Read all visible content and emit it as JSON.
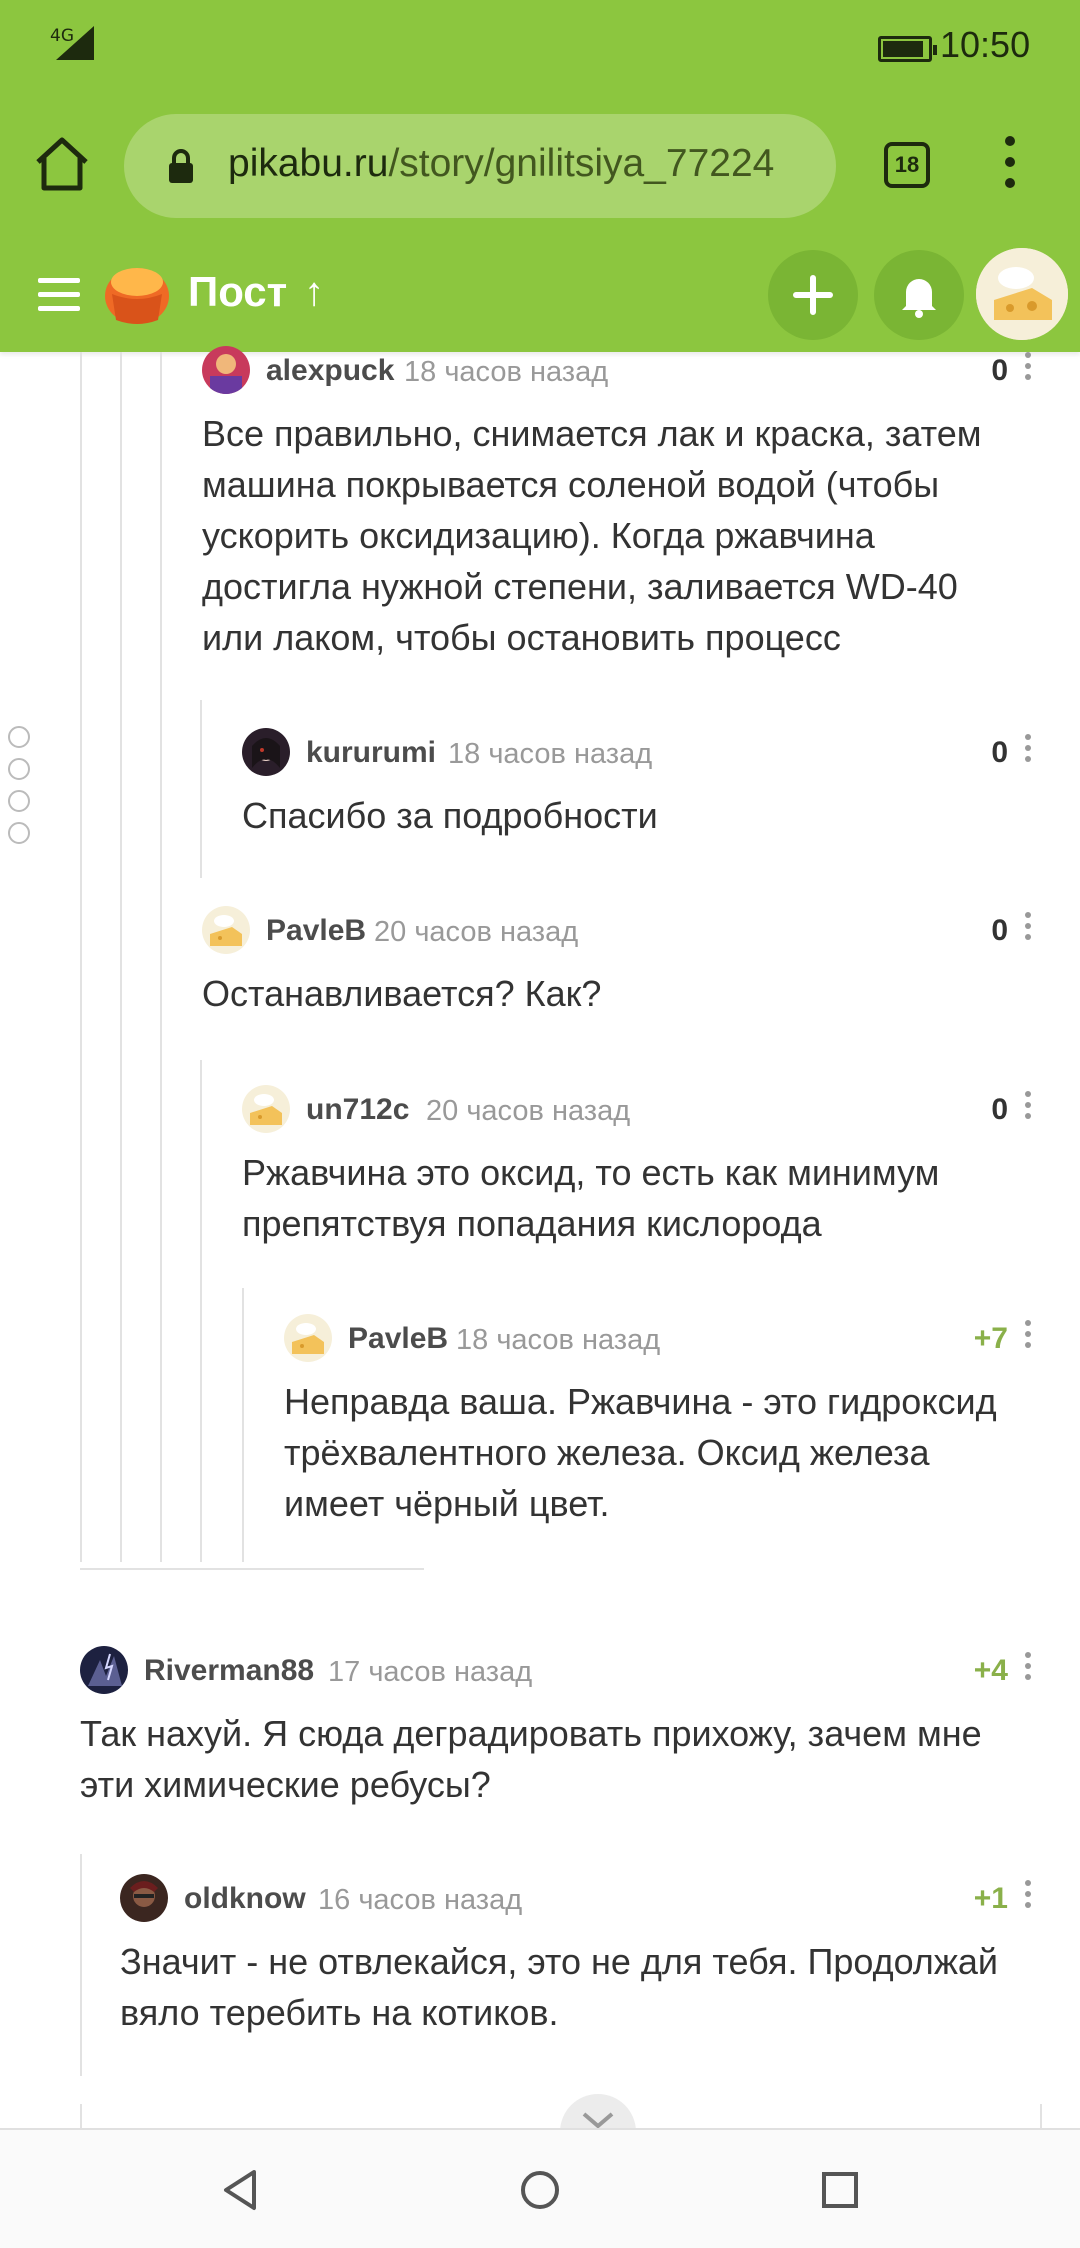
{
  "status_bar": {
    "network": "4G",
    "time": "10:50"
  },
  "browser": {
    "url_host": "pikabu.ru",
    "url_path": "/story/gnilitsiya_77224",
    "tab_count": "18"
  },
  "header": {
    "title": "Пост",
    "up_arrow": "↑"
  },
  "comments": [
    {
      "author": "alexpuck",
      "time": "18 часов назад",
      "rating": "0",
      "lines": [
        "Все правильно, снимается лак и краска, затем",
        "машина покрывается соленой водой (чтобы",
        "ускорить оксидизацию). Когда ржавчина",
        "достигла нужной степени, заливается WD-40",
        "или лаком, чтобы остановить процесс"
      ]
    },
    {
      "author": "kururumi",
      "time": "18 часов назад",
      "rating": "0",
      "lines": [
        "Спасибо за подробности"
      ]
    },
    {
      "author": "PavleB",
      "time": "20 часов назад",
      "rating": "0",
      "lines": [
        "Останавливается? Как?"
      ]
    },
    {
      "author": "un712c",
      "time": "20 часов назад",
      "rating": "0",
      "lines": [
        "Ржавчина это оксид, то есть как минимум",
        "препятствуя попадания кислорода"
      ]
    },
    {
      "author": "PavleB",
      "time": "18 часов назад",
      "rating": "+7",
      "lines": [
        "Неправда ваша. Ржавчина - это гидроксид",
        "трёхвалентного железа. Оксид железа",
        "имеет чёрный цвет."
      ]
    },
    {
      "author": "Riverman88",
      "time": "17 часов назад",
      "rating": "+4",
      "lines": [
        "Так нахуй. Я сюда деградировать прихожу, зачем мне",
        "эти химические ребусы?"
      ]
    },
    {
      "author": "oldknow",
      "time": "16 часов назад",
      "rating": "+1",
      "lines": [
        "Значит  - не отвлекайся, это не для тебя. Продолжай",
        "вяло теребить на котиков."
      ]
    }
  ],
  "colors": {
    "brand_green": "#8cc63f",
    "positive": "#8ab04a"
  }
}
